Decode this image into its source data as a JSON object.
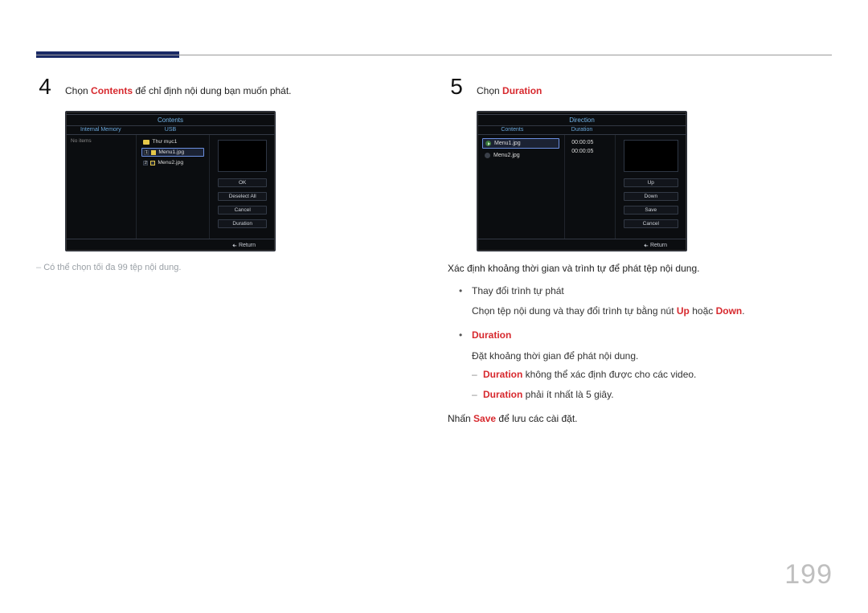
{
  "page_number": "199",
  "step4": {
    "num": "4",
    "text_pre": "Chọn ",
    "hl": "Contents",
    "text_post": " để chỉ định nội dung bạn muốn phát.",
    "note": "Có thể chọn tối đa 99 tệp nội dung."
  },
  "step5": {
    "num": "5",
    "text_pre": "Chọn ",
    "hl": "Duration"
  },
  "right_block": {
    "intro": "Xác định khoảng thời gian và trình tự để phát tệp nội dung.",
    "bullet1_title": "Thay đổi trình tự phát",
    "bullet1_line_pre": "Chọn tệp nội dung và thay đổi trình tự bằng nút ",
    "bullet1_up": "Up",
    "bullet1_line_mid": " hoặc ",
    "bullet1_down": "Down",
    "bullet1_line_end": ".",
    "bullet2_title": "Duration",
    "bullet2_line": "Đặt khoảng thời gian để phát nội dung.",
    "dash1_hl": "Duration",
    "dash1_rest": " không thể xác định được cho các video.",
    "dash2_hl": "Duration",
    "dash2_rest": " phải ít nhất là 5 giây.",
    "outro_pre": "Nhấn ",
    "outro_hl": "Save",
    "outro_post": " để lưu các cài đặt."
  },
  "screenshot1": {
    "title": "Contents",
    "col_left": "Internal Memory",
    "col_right": "USB",
    "no_items": "No items",
    "folder": "Thư mục1",
    "num1": "1",
    "file1": "Menu1.jpg",
    "num2": "2",
    "file2": "Menu2.jpg",
    "btns": [
      "OK",
      "Deselect All",
      "Cancel",
      "Duration"
    ],
    "return": "Return"
  },
  "screenshot2": {
    "title": "Direction",
    "col_left": "Contents",
    "col_right": "Duration",
    "file1": "Menu1.jpg",
    "file2": "Menu2.jpg",
    "dur1": "00:00:05",
    "dur2": "00:00:05",
    "btns": [
      "Up",
      "Down",
      "Save",
      "Cancel"
    ],
    "return": "Return"
  }
}
